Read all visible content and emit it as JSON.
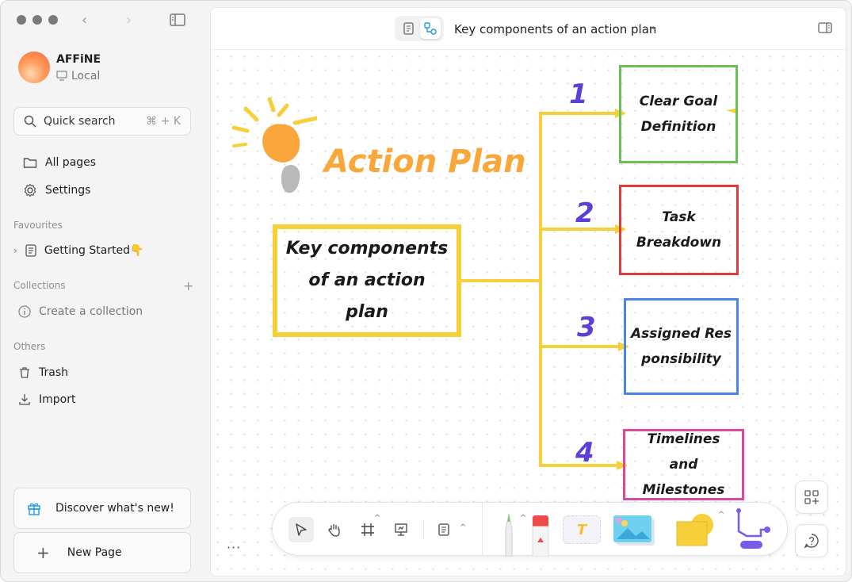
{
  "sidebar": {
    "workspace_name": "AFFiNE",
    "workspace_type": "Local",
    "search_label": "Quick search",
    "search_shortcut": "⌘ + K",
    "all_pages": "All pages",
    "settings": "Settings",
    "favourites_title": "Favourites",
    "favourite_page": "Getting Started👇",
    "collections_title": "Collections",
    "create_collection": "Create a collection",
    "others_title": "Others",
    "trash": "Trash",
    "import": "Import",
    "discover": "Discover what's new!",
    "new_page": "New Page"
  },
  "header": {
    "title": "Key components of an action plan"
  },
  "canvas": {
    "heading": "Action Plan",
    "root_box": "Key components of an action plan",
    "branches": [
      {
        "number": "1",
        "label": "Clear Goal Definition",
        "color": "#6bbf59"
      },
      {
        "number": "2",
        "label": "Task Breakdown",
        "color": "#e03c3c"
      },
      {
        "number": "3",
        "label": "Assigned Responsibility",
        "color": "#4a86e8"
      },
      {
        "number": "4",
        "label": "Timelines and Milestones",
        "color": "#d94a9a"
      }
    ],
    "connector_color": "#f7cf3b",
    "root_color": "#f7cf3b",
    "heading_color": "#f9a63a",
    "number_color": "#5b3fd6"
  },
  "toolbar": {
    "more": "···",
    "text_tool": "T"
  },
  "colors": {
    "accent": "#1e96eb"
  }
}
